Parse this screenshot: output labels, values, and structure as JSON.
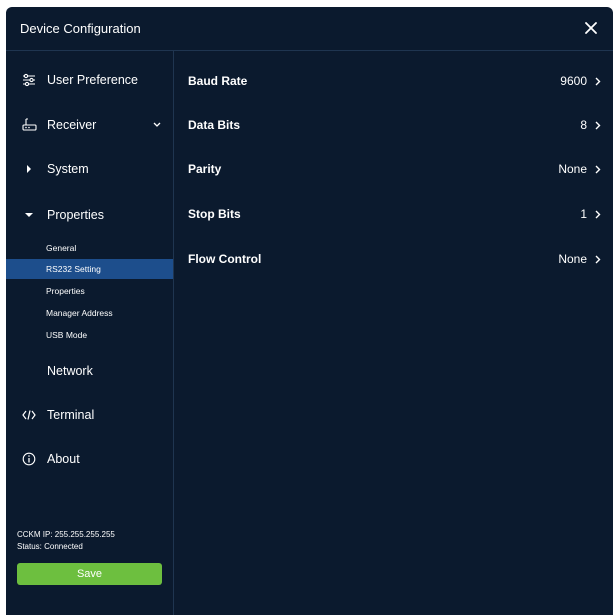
{
  "window": {
    "title": "Device Configuration"
  },
  "sidebar": {
    "items": [
      {
        "label": "User Preference",
        "icon": "sliders-icon"
      },
      {
        "label": "Receiver",
        "icon": "router-icon",
        "expanded": true
      },
      {
        "label": "System",
        "icon": "caret-right-icon"
      },
      {
        "label": "Properties",
        "icon": "caret-down-icon",
        "expanded": true
      },
      {
        "label": "Network"
      },
      {
        "label": "Terminal",
        "icon": "code-icon"
      },
      {
        "label": "About",
        "icon": "info-icon"
      }
    ],
    "subitems": [
      {
        "label": "General"
      },
      {
        "label": "RS232 Setting",
        "active": true
      },
      {
        "label": "Properties"
      },
      {
        "label": "Manager Address"
      },
      {
        "label": "USB Mode"
      }
    ],
    "status": {
      "ip_line": "CCKM IP:  255.255.255.255",
      "status_line": "Status: Connected"
    },
    "save_label": "Save"
  },
  "settings": [
    {
      "name": "Baud Rate",
      "value": "9600"
    },
    {
      "name": "Data Bits",
      "value": "8"
    },
    {
      "name": "Parity",
      "value": "None"
    },
    {
      "name": "Stop Bits",
      "value": "1"
    },
    {
      "name": "Flow Control",
      "value": "None"
    }
  ],
  "colors": {
    "background": "#0b1a2e",
    "divider": "#1f3550",
    "active": "#1d4e8c",
    "save": "#6dbf3f"
  }
}
